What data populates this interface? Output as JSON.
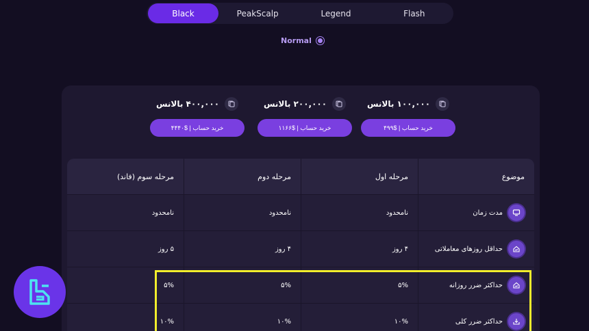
{
  "tabs": [
    {
      "label": "Black",
      "active": true
    },
    {
      "label": "PeakScalp",
      "active": false
    },
    {
      "label": "Legend",
      "active": false
    },
    {
      "label": "Flash",
      "active": false
    }
  ],
  "mode": {
    "label": "Normal"
  },
  "plans": [
    {
      "balance": "۴۰۰,۰۰۰ بالانس",
      "button": "خرید حساب | $۴۴۴۰"
    },
    {
      "balance": "۲۰۰,۰۰۰ بالانس",
      "button": "خرید حساب | $۱۱۶۶"
    },
    {
      "balance": "۱۰۰,۰۰۰ بالانس",
      "button": "خرید حساب | $۴۹۹"
    }
  ],
  "table": {
    "headers": [
      "موضوع",
      "مرحله اول",
      "مرحله دوم",
      "مرحله سوم (فاند)"
    ],
    "rows": [
      {
        "topic": "مدت زمان",
        "values": [
          "نامحدود",
          "نامحدود",
          "نامحدود"
        ]
      },
      {
        "topic": "حداقل روزهای معاملاتی",
        "values": [
          "۴ روز",
          "۴ روز",
          "۵ روز"
        ]
      },
      {
        "topic": "حداکثر ضرر روزانه",
        "values": [
          "۵%",
          "۵%",
          "۵%"
        ]
      },
      {
        "topic": "حداکثر ضرر کلی",
        "values": [
          "۱۰%",
          "۱۰%",
          "۱۰%"
        ]
      }
    ]
  },
  "colors": {
    "accent": "#6a2be6",
    "highlight": "#f2ee2c",
    "background": "#130e22"
  }
}
